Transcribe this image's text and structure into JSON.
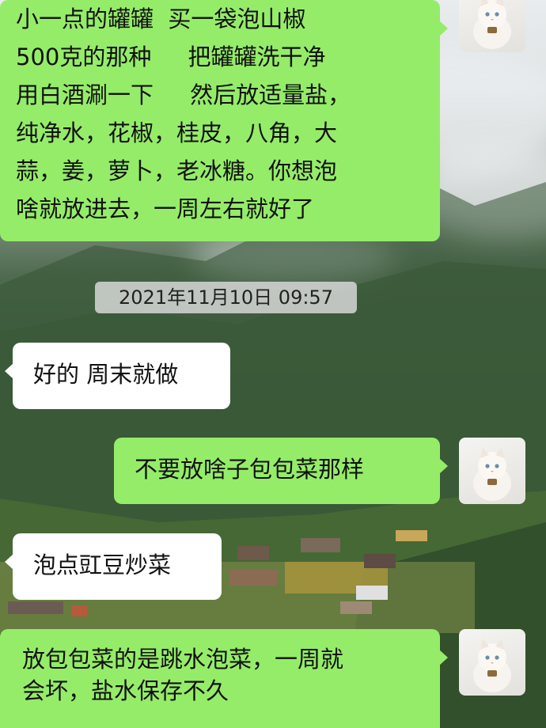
{
  "background": {
    "description_icon": "mountain-valley-wallpaper"
  },
  "colors": {
    "outgoing_bubble": "#95ec69",
    "incoming_bubble": "#ffffff",
    "timestamp_bg": "#dcdcdc"
  },
  "messages": [
    {
      "direction": "outgoing",
      "lines": [
        "小一点的罐罐  买一袋泡山椒",
        "500克的那种     把罐罐洗干净",
        "用白酒涮一下     然后放适量盐，",
        "纯净水，花椒，桂皮，八角，大",
        "蒜，姜，萝卜，老冰糖。你想泡",
        "啥就放进去，一周左右就好了"
      ],
      "avatar_icon": "white-cat-avatar-icon"
    },
    {
      "direction": "timestamp",
      "text": "2021年11月10日 09:57"
    },
    {
      "direction": "incoming",
      "text": "好的 周末就做"
    },
    {
      "direction": "outgoing",
      "text": "不要放啥子包包菜那样",
      "avatar_icon": "white-cat-avatar-icon"
    },
    {
      "direction": "incoming",
      "text": "泡点豇豆炒菜"
    },
    {
      "direction": "outgoing",
      "lines": [
        "放包包菜的是跳水泡菜，一周就",
        "会坏，盐水保存不久"
      ],
      "avatar_icon": "white-cat-avatar-icon"
    }
  ]
}
